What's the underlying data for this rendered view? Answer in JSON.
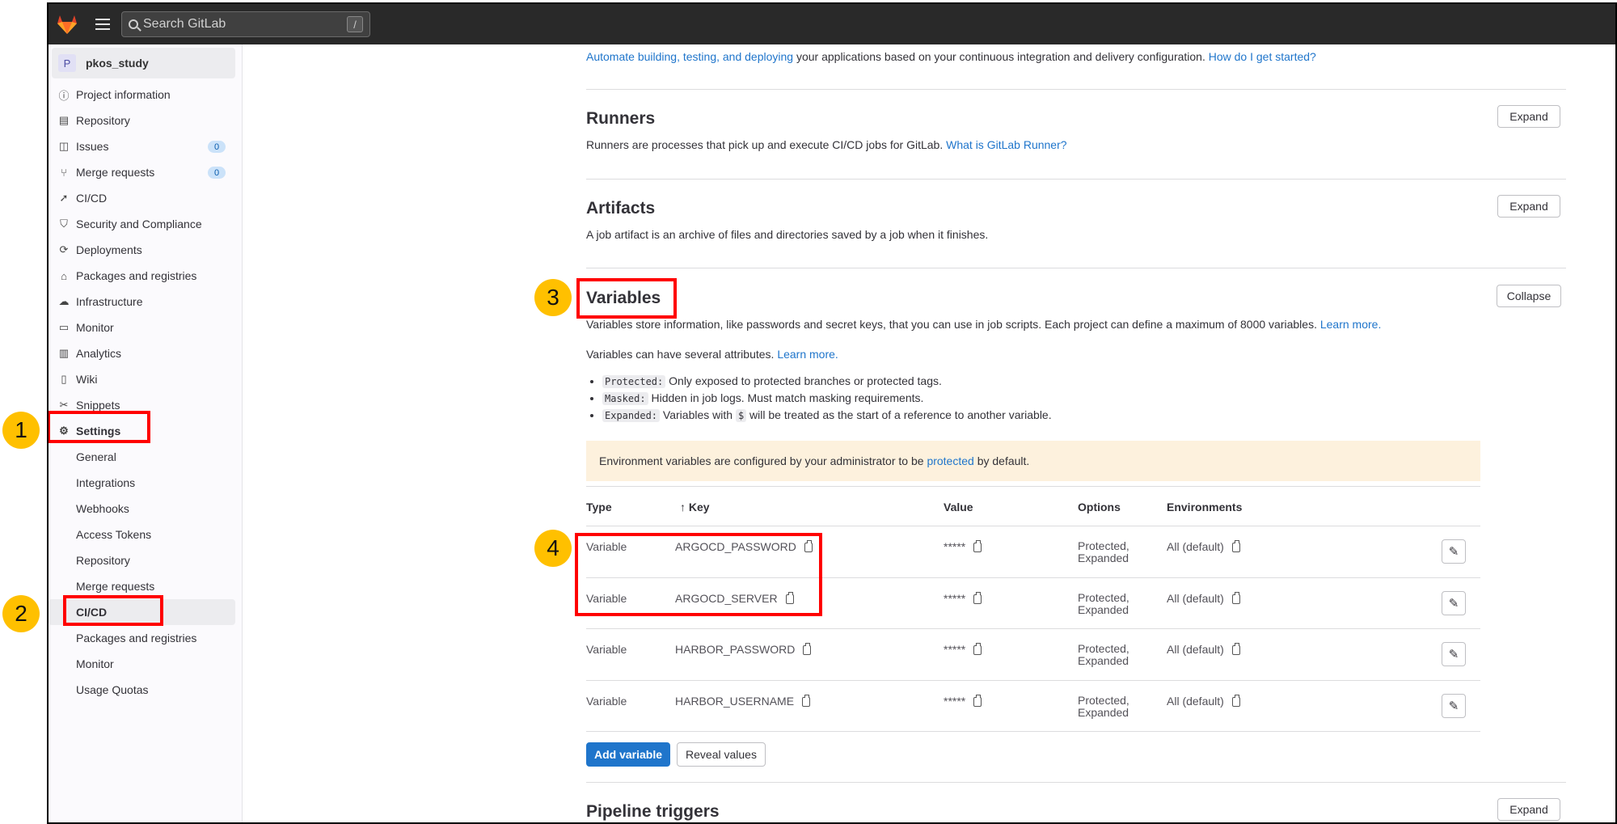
{
  "topbar": {
    "search_placeholder": "Search GitLab",
    "search_shortcut": "/"
  },
  "sidebar": {
    "project_avatar": "P",
    "project_name": "pkos_study",
    "items": [
      {
        "label": "Project information",
        "icon": "info-icon"
      },
      {
        "label": "Repository",
        "icon": "doc-icon"
      },
      {
        "label": "Issues",
        "icon": "issues-icon",
        "badge": "0"
      },
      {
        "label": "Merge requests",
        "icon": "merge-icon",
        "badge": "0"
      },
      {
        "label": "CI/CD",
        "icon": "rocket-icon"
      },
      {
        "label": "Security and Compliance",
        "icon": "shield-icon"
      },
      {
        "label": "Deployments",
        "icon": "deploy-icon"
      },
      {
        "label": "Packages and registries",
        "icon": "package-icon"
      },
      {
        "label": "Infrastructure",
        "icon": "cloud-icon"
      },
      {
        "label": "Monitor",
        "icon": "monitor-icon"
      },
      {
        "label": "Analytics",
        "icon": "chart-icon"
      },
      {
        "label": "Wiki",
        "icon": "book-icon"
      },
      {
        "label": "Snippets",
        "icon": "scissors-icon"
      },
      {
        "label": "Settings",
        "icon": "gear-icon"
      }
    ],
    "settings_sub": [
      "General",
      "Integrations",
      "Webhooks",
      "Access Tokens",
      "Repository",
      "Merge requests",
      "CI/CD",
      "Packages and registries",
      "Monitor",
      "Usage Quotas"
    ]
  },
  "intro": {
    "link": "Automate building, testing, and deploying",
    "text": " your applications based on your continuous integration and delivery configuration. ",
    "help": "How do I get started?"
  },
  "runners": {
    "title": "Runners",
    "desc": "Runners are processes that pick up and execute CI/CD jobs for GitLab. ",
    "link": "What is GitLab Runner?",
    "button": "Expand"
  },
  "artifacts": {
    "title": "Artifacts",
    "desc": "A job artifact is an archive of files and directories saved by a job when it finishes.",
    "button": "Expand"
  },
  "variables": {
    "title": "Variables",
    "button": "Collapse",
    "desc": "Variables store information, like passwords and secret keys, that you can use in job scripts. Each project can define a maximum of 8000 variables. ",
    "learn_more": "Learn more.",
    "attrs_text": "Variables can have several attributes. ",
    "attrs_link": "Learn more.",
    "bullets": [
      {
        "code": "Protected:",
        "text": " Only exposed to protected branches or protected tags."
      },
      {
        "code": "Masked:",
        "text": " Hidden in job logs. Must match masking requirements."
      },
      {
        "code": "Expanded:",
        "text_before": " Variables with ",
        "dollar": "$",
        "text_after": " will be treated as the start of a reference to another variable."
      }
    ],
    "alert_before": "Environment variables are configured by your administrator to be ",
    "alert_link": "protected",
    "alert_after": " by default.",
    "columns": {
      "type": "Type",
      "key": "↑ Key",
      "value": "Value",
      "options": "Options",
      "environments": "Environments"
    },
    "rows": [
      {
        "type": "Variable",
        "key": "ARGOCD_PASSWORD",
        "value": "*****",
        "options1": "Protected,",
        "options2": "Expanded",
        "env": "All (default)"
      },
      {
        "type": "Variable",
        "key": "ARGOCD_SERVER",
        "value": "*****",
        "options1": "Protected,",
        "options2": "Expanded",
        "env": "All (default)"
      },
      {
        "type": "Variable",
        "key": "HARBOR_PASSWORD",
        "value": "*****",
        "options1": "Protected,",
        "options2": "Expanded",
        "env": "All (default)"
      },
      {
        "type": "Variable",
        "key": "HARBOR_USERNAME",
        "value": "*****",
        "options1": "Protected,",
        "options2": "Expanded",
        "env": "All (default)"
      }
    ],
    "add_button": "Add variable",
    "reveal_button": "Reveal values"
  },
  "pipeline_triggers": {
    "title": "Pipeline triggers",
    "button": "Expand"
  },
  "annotations": [
    "1",
    "2",
    "3",
    "4"
  ],
  "colors": {
    "annotation_box": "#ff0000",
    "annotation_badge": "#ffc000",
    "primary": "#1f75cb",
    "topbar": "#292929"
  }
}
